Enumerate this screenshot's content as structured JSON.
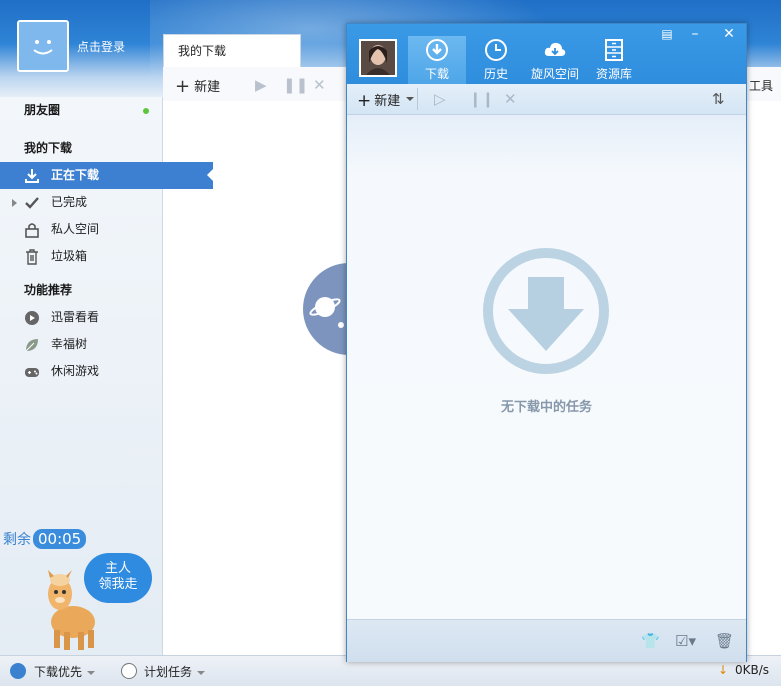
{
  "main_window": {
    "login_link": "点击登录",
    "tab_label": "我的下载",
    "toolbar": {
      "new_label": "新建",
      "tools_label": "工具"
    },
    "sidebar": {
      "friends": "朋友圈",
      "my_downloads_header": "我的下载",
      "items": [
        {
          "label": "正在下载",
          "icon": "download-icon"
        },
        {
          "label": "已完成",
          "icon": "check-icon"
        },
        {
          "label": "私人空间",
          "icon": "lock-icon"
        },
        {
          "label": "垃圾箱",
          "icon": "trash-icon"
        }
      ],
      "features_header": "功能推荐",
      "features": [
        {
          "label": "迅雷看看",
          "icon": "play-bubble-icon"
        },
        {
          "label": "幸福树",
          "icon": "leaf-icon"
        },
        {
          "label": "休闲游戏",
          "icon": "gamepad-icon"
        }
      ]
    },
    "remain_label": "剩余",
    "remain_time": "00:05",
    "mascot_bubble_line1": "主人",
    "mascot_bubble_line2": "领我走",
    "statusbar": {
      "download_priority": "下载优先",
      "scheduled_task": "计划任务",
      "speed": "0KB/s"
    }
  },
  "mini_window": {
    "nav": [
      {
        "label": "下载",
        "icon": "download-circle-icon",
        "active": true
      },
      {
        "label": "历史",
        "icon": "clock-icon",
        "active": false
      },
      {
        "label": "旋风空间",
        "icon": "cloud-icon",
        "active": false
      },
      {
        "label": "资源库",
        "icon": "cabinet-icon",
        "active": false
      }
    ],
    "toolbar": {
      "new_label": "新建"
    },
    "empty_text": "无下载中的任务"
  },
  "colors": {
    "accent": "#3d7fd0",
    "mini_header": "#2f8ddd",
    "empty_icon": "#b9d2e3"
  }
}
